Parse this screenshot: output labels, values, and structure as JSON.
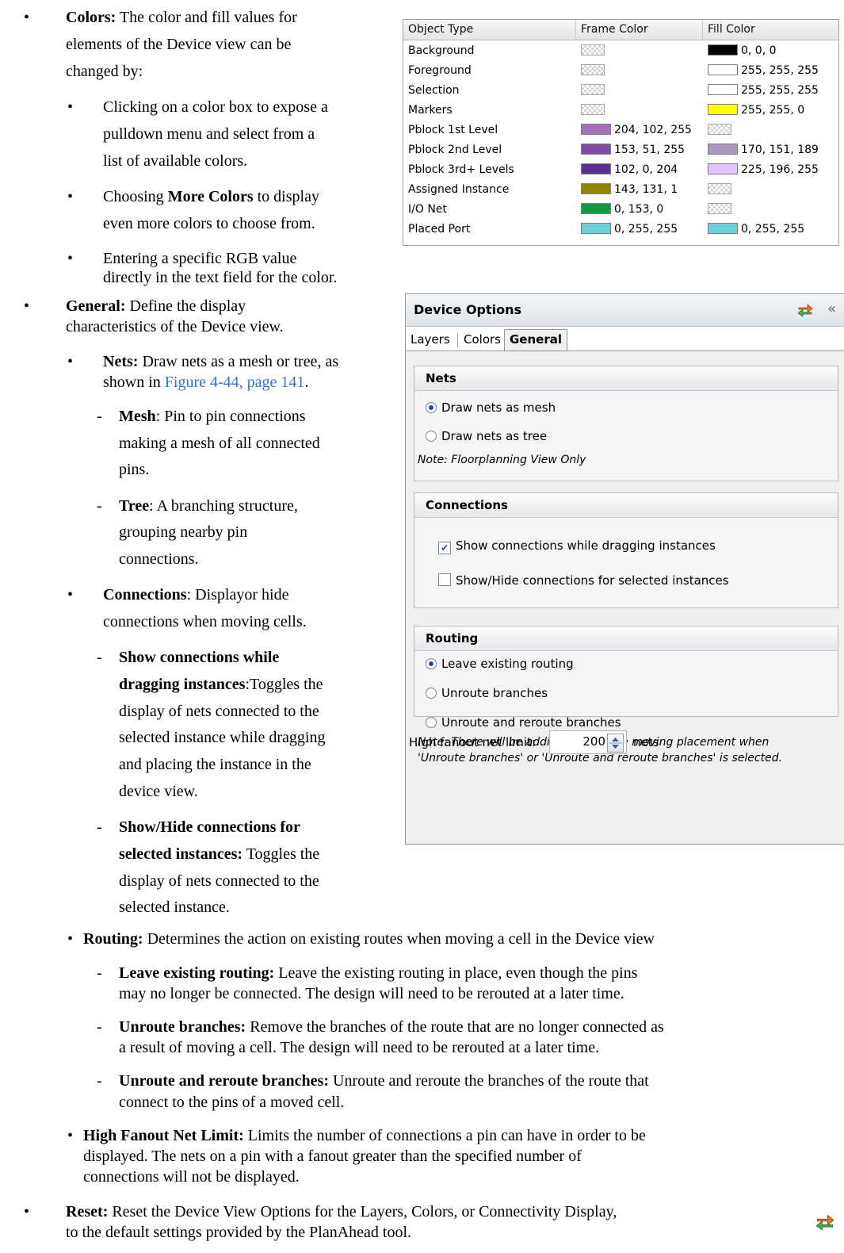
{
  "colors_bullet": {
    "label": "Colors:",
    "text_l1": " The color and fill values for",
    "text_l2": "elements of the Device view can be",
    "text_l3": "changed by:",
    "sub1_l1": "Clicking on a color box to expose a",
    "sub1_l2": "pulldown menu and select from a",
    "sub1_l3": "list of available colors.",
    "sub2_l1_pre": "Choosing ",
    "sub2_l1_bold": "More Colors",
    "sub2_l1_post": " to display",
    "sub2_l2": "even more colors to choose from.",
    "sub3_l1": "Entering a specific RGB value",
    "sub3_l2": "directly in the text field for the color."
  },
  "color_table": {
    "headers": [
      "Object Type",
      "Frame Color",
      "Fill Color"
    ],
    "rows": [
      {
        "type": "Background",
        "frame": "",
        "frame_color": "checker",
        "fill": "0, 0, 0",
        "fill_color": "#000000"
      },
      {
        "type": "Foreground",
        "frame": "",
        "frame_color": "checker",
        "fill": "255, 255, 255",
        "fill_color": "#ffffff"
      },
      {
        "type": "Selection",
        "frame": "",
        "frame_color": "checker",
        "fill": "255, 255, 255",
        "fill_color": "#ffffff"
      },
      {
        "type": "Markers",
        "frame": "",
        "frame_color": "checker",
        "fill": "255, 255, 0",
        "fill_color": "#ffff00"
      },
      {
        "type": "Pblock 1st Level",
        "frame": "204, 102, 255",
        "frame_color": "#a572b8",
        "fill": "",
        "fill_color": "checker"
      },
      {
        "type": "Pblock 2nd Level",
        "frame": "153, 51, 255",
        "frame_color": "#7e4ca6",
        "fill": "170, 151, 189",
        "fill_color": "#aa97bd"
      },
      {
        "type": "Pblock 3rd+ Levels",
        "frame": "102, 0, 204",
        "frame_color": "#5a2f94",
        "fill": "225, 196, 255",
        "fill_color": "#e1c4ff"
      },
      {
        "type": "Assigned Instance",
        "frame": "143, 131, 1",
        "frame_color": "#8f8301",
        "fill": "",
        "fill_color": "checker"
      },
      {
        "type": "I/O Net",
        "frame": "0, 153, 0",
        "frame_color": "#129b40",
        "fill": "",
        "fill_color": "checker"
      },
      {
        "type": "Placed Port",
        "frame": "0, 255, 255",
        "frame_color": "#6cd0dc",
        "fill": "0, 255, 255",
        "fill_color": "#6cd0dc"
      }
    ]
  },
  "general_bullet": {
    "label": "General:",
    "text_l1": " Define the display",
    "text_l2": "characteristics of the Device view.",
    "nets_label": "Nets:",
    "nets_l1": " Draw nets as a mesh or tree, as",
    "nets_l2_pre": "shown in ",
    "nets_link": "Figure 4-44, page 141",
    "nets_l2_post": ".",
    "mesh_label": "Mesh",
    "mesh_l1": ": Pin to pin connections",
    "mesh_l2": "making a mesh of all connected",
    "mesh_l3": "pins.",
    "tree_label": "Tree",
    "tree_l1": ": A branching structure,",
    "tree_l2": "grouping nearby pin",
    "tree_l3": "connections.",
    "conn_label": "Connections",
    "conn_l1": ": Displayor hide",
    "conn_l2": "connections when moving cells.",
    "show_l1": "Show connections while",
    "show_l2_bold": "dragging instances",
    "show_l2_post": ":Toggles the",
    "show_l3": "display of nets connected to the",
    "show_l4": "selected instance while dragging",
    "show_l5": "and placing the instance in the",
    "show_l6": "device view.",
    "hide_l1": "Show/Hide connections for",
    "hide_l2_bold": "selected instances:",
    "hide_l2_post": " Toggles the",
    "hide_l3": "display of nets connected to the",
    "hide_l4": "selected instance."
  },
  "panel": {
    "title": "Device Options",
    "collapse_glyph": "«",
    "tabs": [
      "Layers",
      "Colors",
      "General"
    ],
    "nets": {
      "header": "Nets",
      "opt1": "Draw nets as mesh",
      "opt2": "Draw nets as tree",
      "note": "Note: Floorplanning View Only"
    },
    "connections": {
      "header": "Connections",
      "opt1": "Show connections while dragging instances",
      "opt2": "Show/Hide connections for selected instances"
    },
    "routing": {
      "header": "Routing",
      "opt1": "Leave existing routing",
      "opt2": "Unroute branches",
      "opt3": "Unroute and reroute branches",
      "note_l1": "Note: There will be additional runtime moving placement when",
      "note_l2": "'Unroute branches' or 'Unroute and reroute branches' is selected."
    },
    "fanout": {
      "label": "High fanout net limit:",
      "value": "200",
      "unit": "nets"
    }
  },
  "routing_bullet": {
    "label": "Routing:",
    "text": " Determines the action on existing routes when moving a cell in the Device view",
    "leave_label": "Leave existing routing:",
    "leave_l1": " Leave the existing routing in place, even though the pins",
    "leave_l2": "may no longer be connected. The design will need to be rerouted at a later time.",
    "unroute_label": "Unroute branches:",
    "unroute_l1": " Remove the branches of the route that are no longer connected as",
    "unroute_l2": "a result of moving a cell. The design will need to be rerouted at a later time.",
    "reroute_label": "Unroute and reroute branches:",
    "reroute_l1": " Unroute and reroute the branches of the route that",
    "reroute_l2": "connect to the pins of a moved cell."
  },
  "fanout_bullet": {
    "label": "High Fanout Net Limit:",
    "l1": " Limits the number of connections a pin can have in order to be",
    "l2": "displayed. The nets on a pin with a fanout greater than the specified number of",
    "l3": "connections will not be displayed."
  },
  "reset_bullet": {
    "label": "Reset:",
    "l1": " Reset the Device View Options for the Layers, Colors, or Connectivity Display,",
    "l2": "to the default settings provided by the PlanAhead tool."
  },
  "glyphs": {
    "bullet": "•",
    "dash": "-"
  }
}
